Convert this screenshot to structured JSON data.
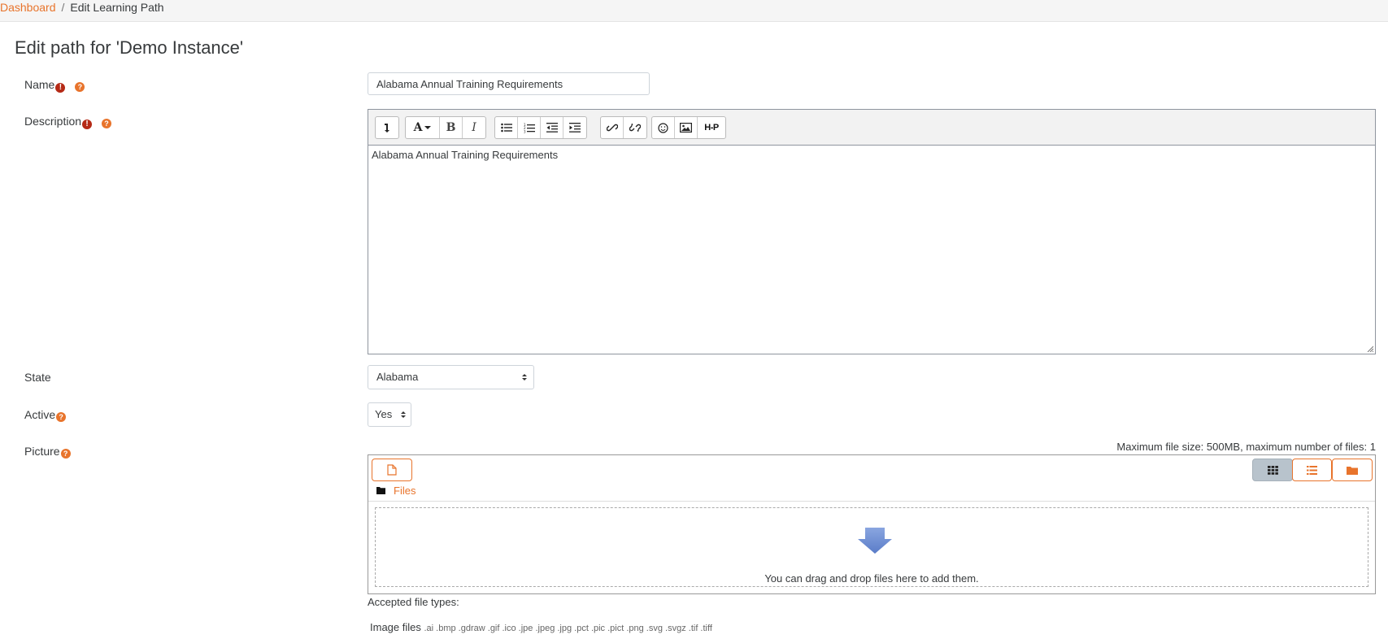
{
  "breadcrumb": {
    "dashboard": "Dashboard",
    "separator": "/",
    "current": "Edit Learning Path"
  },
  "page_title": "Edit path for 'Demo Instance'",
  "fields": {
    "name": {
      "label": "Name",
      "value": "Alabama Annual Training Requirements",
      "required": true
    },
    "description": {
      "label": "Description",
      "value": "Alabama Annual Training Requirements",
      "required": true
    },
    "state": {
      "label": "State",
      "value": "Alabama"
    },
    "active": {
      "label": "Active",
      "value": "Yes"
    },
    "picture": {
      "label": "Picture"
    }
  },
  "editor_toolbar": {
    "groups": [
      [
        "collapse-icon"
      ],
      [
        "font-color-icon",
        "bold-icon",
        "italic-icon"
      ],
      [
        "unordered-list-icon",
        "ordered-list-icon",
        "outdent-icon",
        "indent-icon"
      ],
      [
        "link-icon",
        "unlink-icon"
      ],
      [
        "emoticon-icon",
        "image-icon",
        "h5p-icon"
      ]
    ],
    "h5p_label": "H-P"
  },
  "filepicker": {
    "max_note": "Maximum file size: 500MB, maximum number of files: 1",
    "path_label": "Files",
    "drop_text": "You can drag and drop files here to add them.",
    "view_icons": [
      "grid-view-icon",
      "list-view-icon",
      "tree-view-icon"
    ],
    "active_view": "grid-view-icon"
  },
  "accepted": {
    "title": "Accepted file types:",
    "group": "Image files",
    "extensions": ".ai .bmp .gdraw .gif .ico .jpe .jpeg .jpg .pct .pic .pict .png .svg .svgz .tif .tiff"
  },
  "colors": {
    "accent": "#e8742c",
    "required": "#b52a16",
    "drop_arrow": "#6f8fd4",
    "active_view_bg": "#b8c3cc"
  }
}
